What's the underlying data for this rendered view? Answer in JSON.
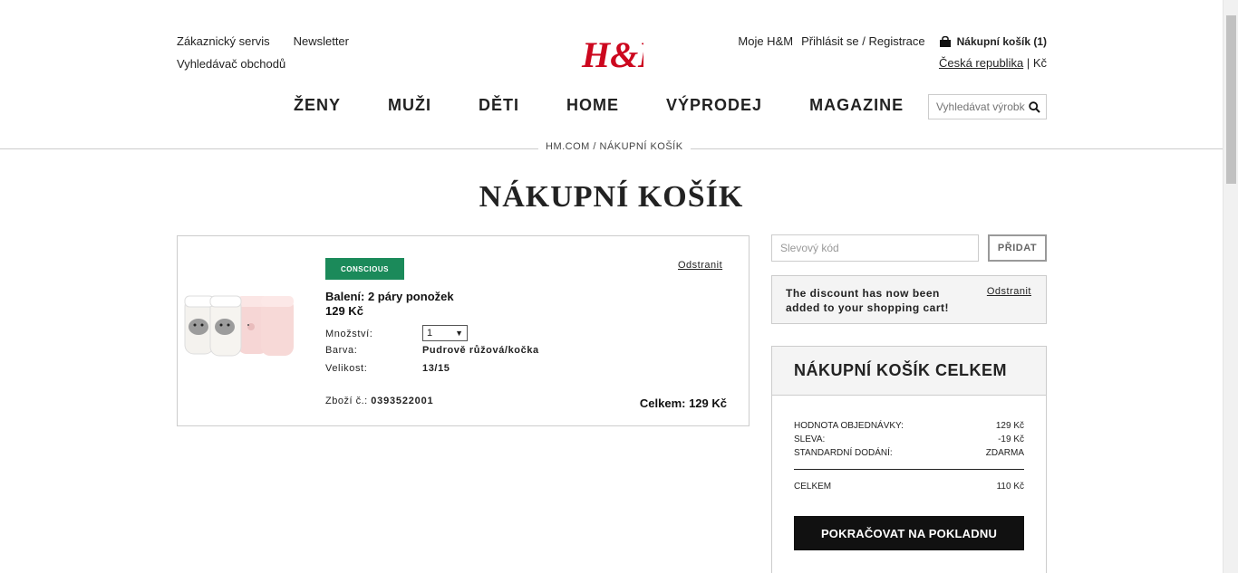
{
  "header": {
    "customer_service": "Zákaznický servis",
    "newsletter": "Newsletter",
    "store_locator": "Vyhledávač obchodů",
    "logo_text": "H&M",
    "my_hm": "Moje H&M",
    "login": "Přihlásit se / Registrace",
    "cart_label": "Nákupní košík (1)",
    "country": "Česká republika",
    "currency_sep": "|",
    "currency": "Kč"
  },
  "nav": {
    "items": [
      "ŽENY",
      "MUŽI",
      "DĚTI",
      "HOME",
      "VÝPRODEJ",
      "MAGAZINE"
    ]
  },
  "search": {
    "placeholder": "Vyhledávat výrobky"
  },
  "breadcrumb": "HM.COM / NÁKUPNÍ KOŠÍK",
  "page_title": "NÁKUPNÍ KOŠÍK",
  "item": {
    "badge": "CONSCIOUS",
    "remove_label": "Odstranit",
    "name": "Balení: 2 páry ponožek",
    "price": "129 Kč",
    "quantity_label": "Množství:",
    "quantity_value": "1",
    "color_label": "Barva:",
    "color_value": "Pudrově růžová/kočka",
    "size_label": "Velikost:",
    "size_value": "13/15",
    "article_label": "Zboží č.:",
    "article_number": "0393522001",
    "total": "Celkem: 129 Kč"
  },
  "promo": {
    "placeholder": "Slevový kód",
    "button": "PŘIDAT"
  },
  "notice": {
    "message": "The discount has now been added to your shopping cart!",
    "remove_label": "Odstranit"
  },
  "summary": {
    "title": "NÁKUPNÍ KOŠÍK CELKEM",
    "rows": [
      {
        "label": "HODNOTA OBJEDNÁVKY:",
        "value": "129 Kč"
      },
      {
        "label": "SLEVA:",
        "value": "-19 Kč"
      },
      {
        "label": "STANDARDNÍ DODÁNÍ:",
        "value": "ZDARMA"
      }
    ],
    "total_label": "CELKEM",
    "total_value": "110 Kč",
    "checkout_button": "POKRAČOVAT NA POKLADNU"
  },
  "colors": {
    "accent_red": "#cc071e",
    "conscious_green": "#1b8a5a",
    "button_black": "#111111"
  }
}
